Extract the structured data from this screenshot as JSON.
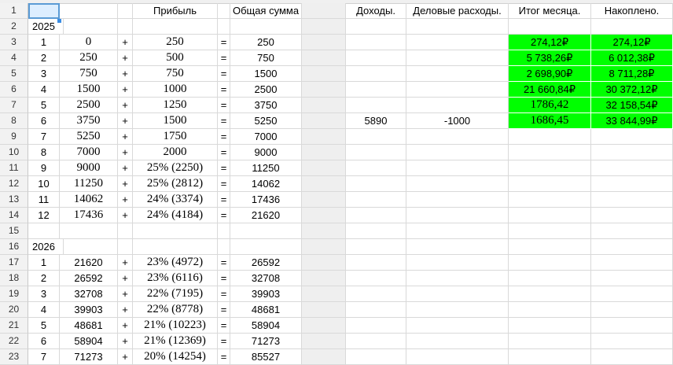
{
  "headers": {
    "D": "Прибыль",
    "F": "Общая сумма",
    "H": "Доходы.",
    "I": "Деловые расходы.",
    "J": "Итог месяца.",
    "K": "Накоплено."
  },
  "year_2025": "2025",
  "year_2026": "2026",
  "rows_2025": [
    {
      "m": "1",
      "prev": "0",
      "op": "+",
      "profit": "250",
      "eq": "=",
      "total": "250"
    },
    {
      "m": "2",
      "prev": "250",
      "op": "+",
      "profit": "500",
      "eq": "=",
      "total": "750"
    },
    {
      "m": "3",
      "prev": "750",
      "op": "+",
      "profit": "750",
      "eq": "=",
      "total": "1500"
    },
    {
      "m": "4",
      "prev": "1500",
      "op": "+",
      "profit": "1000",
      "eq": "=",
      "total": "2500"
    },
    {
      "m": "5",
      "prev": "2500",
      "op": "+",
      "profit": "1250",
      "eq": "=",
      "total": "3750"
    },
    {
      "m": "6",
      "prev": "3750",
      "op": "+",
      "profit": "1500",
      "eq": "=",
      "total": "5250"
    },
    {
      "m": "7",
      "prev": "5250",
      "op": "+",
      "profit": "1750",
      "eq": "=",
      "total": "7000"
    },
    {
      "m": "8",
      "prev": "7000",
      "op": "+",
      "profit": "2000",
      "eq": "=",
      "total": "9000"
    },
    {
      "m": "9",
      "prev": "9000",
      "op": "+",
      "profit": "25% (2250)",
      "eq": "=",
      "total": "11250"
    },
    {
      "m": "10",
      "prev": "11250",
      "op": "+",
      "profit": "25% (2812)",
      "eq": "=",
      "total": "14062"
    },
    {
      "m": "11",
      "prev": "14062",
      "op": "+",
      "profit": "24% (3374)",
      "eq": "=",
      "total": "17436"
    },
    {
      "m": "12",
      "prev": "17436",
      "op": "+",
      "profit": "24% (4184)",
      "eq": "=",
      "total": "21620"
    }
  ],
  "rows_2026": [
    {
      "m": "1",
      "prev": "21620",
      "op": "+",
      "profit": "23% (4972)",
      "eq": "=",
      "total": "26592"
    },
    {
      "m": "2",
      "prev": "26592",
      "op": "+",
      "profit": "23% (6116)",
      "eq": "=",
      "total": "32708"
    },
    {
      "m": "3",
      "prev": "32708",
      "op": "+",
      "profit": "22% (7195)",
      "eq": "=",
      "total": "39903"
    },
    {
      "m": "4",
      "prev": "39903",
      "op": "+",
      "profit": "22% (8778)",
      "eq": "=",
      "total": "48681"
    },
    {
      "m": "5",
      "prev": "48681",
      "op": "+",
      "profit": "21% (10223)",
      "eq": "=",
      "total": "58904"
    },
    {
      "m": "6",
      "prev": "58904",
      "op": "+",
      "profit": "21% (12369)",
      "eq": "=",
      "total": "71273"
    },
    {
      "m": "7",
      "prev": "71273",
      "op": "+",
      "profit": "20% (14254)",
      "eq": "=",
      "total": "85527"
    }
  ],
  "finance": [
    {
      "income": "",
      "expenses": "",
      "month_total": "274,12₽",
      "accumulated": "274,12₽"
    },
    {
      "income": "",
      "expenses": "",
      "month_total": "5 738,26₽",
      "accumulated": "6 012,38₽"
    },
    {
      "income": "",
      "expenses": "",
      "month_total": "2 698,90₽",
      "accumulated": "8 711,28₽"
    },
    {
      "income": "",
      "expenses": "",
      "month_total": "21 660,84₽",
      "accumulated": "30 372,12₽"
    },
    {
      "income": "",
      "expenses": "",
      "month_total": "1786,42",
      "accumulated": "32 158,54₽"
    },
    {
      "income": "5890",
      "expenses": "-1000",
      "month_total": "1686,45",
      "accumulated": "33 844,99₽"
    }
  ],
  "colors": {
    "highlight": "#00ff00",
    "selection": "#ddeeff"
  }
}
